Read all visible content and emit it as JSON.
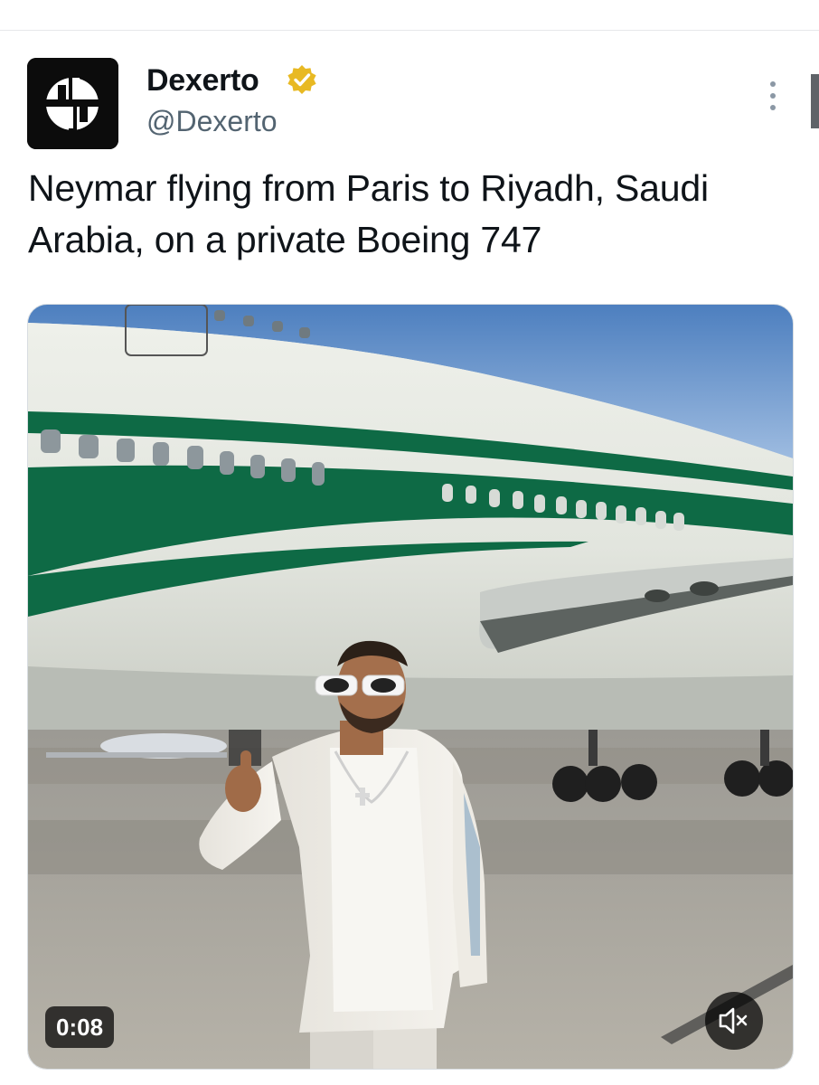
{
  "tweet": {
    "author": {
      "display_name": "Dexerto",
      "handle": "@Dexerto",
      "verified": true,
      "avatar_icon": "dexerto-logo",
      "badge_color": "#e8b923"
    },
    "text": "Neymar flying from Paris to Riyadh, Saudi Arabia, on a private Boeing 747",
    "media": {
      "type": "video",
      "description_icon": "video-thumbnail",
      "duration": "0:08",
      "muted": true
    }
  },
  "colors": {
    "text_primary": "#0f1419",
    "text_secondary": "#536471",
    "plane_green": "#0e6a45"
  },
  "icons": {
    "more": "more-vertical-icon",
    "mute": "speaker-muted-icon",
    "verified": "verified-badge-icon"
  }
}
